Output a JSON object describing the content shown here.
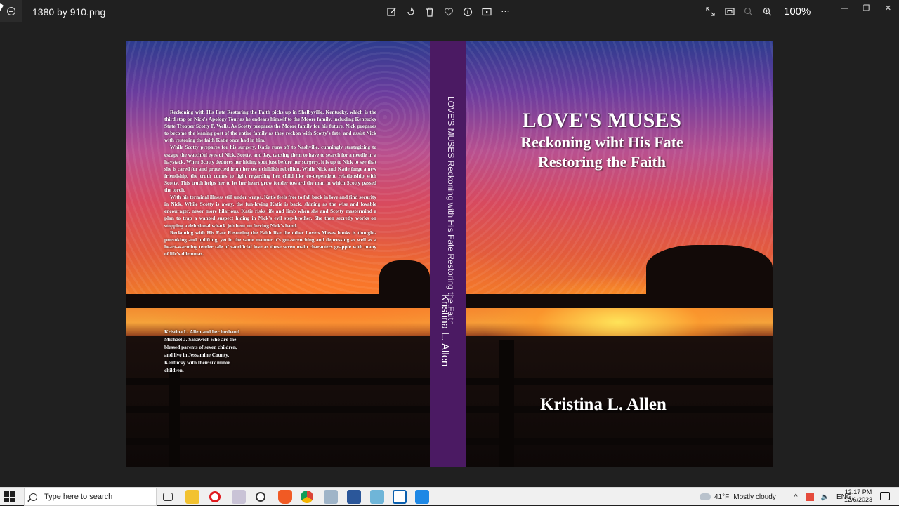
{
  "window": {
    "filename": "1380 by  910.png",
    "zoom": "100%"
  },
  "toolbar": {
    "edit_icon": "edit-icon",
    "rotate_icon": "rotate-icon",
    "delete_icon": "trash-icon",
    "favorite_icon": "heart-icon",
    "info_icon": "info-icon",
    "slideshow_icon": "slideshow-icon",
    "more_label": "···"
  },
  "book": {
    "back_paragraphs": [
      "Reckoning with His Fate Restoring the Faith picks up in Shelbyville, Kentucky, which is the third stop on Nick's Apology Tour as he endears himself to the Moore family, including Kentucky State Trooper Scotty P. Wells. As Scotty prepares the Moore family for his future, Nick prepares to become the leaning post of the entire family as they reckon with Scotty's fate, and assist Nick with restoring the faith Katie once had in him.",
      "While Scotty prepares for his surgery, Katie runs off to Nashville, cunningly strategizing to escape the watchful eyes of Nick, Scotty, and Jay, causing them to have to search for a needle in a haystack. When Scotty deduces her hiding spot just before her surgery, it is up to Nick to see that she is cared for and protected from her own childish rebellion. While Nick and Katie forge a new friendship, the truth comes to light regarding her child like co-dependent relationship with Scotty. This truth helps her to let her heart grow fonder toward the man in which Scotty passed the torch.",
      "With his terminal illness still under wraps, Katie feels free to fall back in love and find security in Nick. While Scotty is away, the fun-loving Katie is back, shining as the wise and lovable encourager, never more hilarious. Katie risks life and limb when she and Scotty mastermind a plan to trap a wanted suspect hiding in Nick's evil step-brother. She then secretly works on stopping a delusional whack job bent on forcing Nick's hand.",
      "Reckoning with His Fate Restoring the Faith like the other Love's Muses books is thought-provoking and uplifting, yet in the same manner it's gut-wrenching and depressing as well as a heart-warming tender tale of sacrificial love as these seven main characters grapple with many of life's dilemmas."
    ],
    "bio": [
      "Kristina L. Allen and her husband",
      "Michael J. Sakowich who are the",
      "blessed parents of seven children,",
      " and live in Jessamine County,",
      " Kentucky with their six minor",
      " children."
    ],
    "spine_title": "LOVE'S MUSES  Reckoning with His Fate Restoring the Faith",
    "spine_author": "Kristina L. Allen",
    "front_title": "LOVE'S MUSES",
    "front_sub1": "Reckoning wiht His Fate",
    "front_sub2": "Restoring the Faith",
    "front_author": "Kristina L. Allen"
  },
  "taskbar": {
    "search_placeholder": "Type here to search",
    "weather_temp": "41°F",
    "weather_text": "Mostly cloudy",
    "lang": "ENG",
    "time": "12:17 PM",
    "date": "12/6/2023"
  },
  "colors": {
    "spine": "#4b1a63",
    "background": "#202020"
  }
}
